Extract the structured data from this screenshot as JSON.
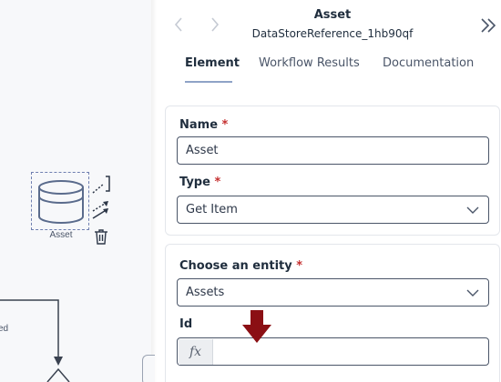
{
  "canvas": {
    "node_label": "Asset",
    "edge_fragment": "ed"
  },
  "panel": {
    "title": "Asset",
    "subtitle": "DataStoreReference_1hb90qf",
    "tabs": [
      "Element",
      "Workflow Results",
      "Documentation"
    ],
    "active_tab": "Element"
  },
  "card1": {
    "name_label": "Name",
    "name_value": "Asset",
    "type_label": "Type",
    "type_value": "Get Item"
  },
  "card2": {
    "entity_label": "Choose an entity",
    "entity_value": "Assets",
    "id_label": "Id",
    "id_value": "",
    "fx_symbol": "fx"
  },
  "required_marker": "*",
  "colors": {
    "accent_arrow": "#8b0f14",
    "tab_underline": "#8fa3c7",
    "node_stroke": "#5a6b8c",
    "required": "#c53030"
  },
  "icons": [
    "database-icon",
    "connect-icon",
    "arrows-icon",
    "trash-icon",
    "chevron-left-icon",
    "chevron-right-icon",
    "double-chevron-right-icon",
    "chevron-down-icon",
    "down-arrow-icon"
  ]
}
